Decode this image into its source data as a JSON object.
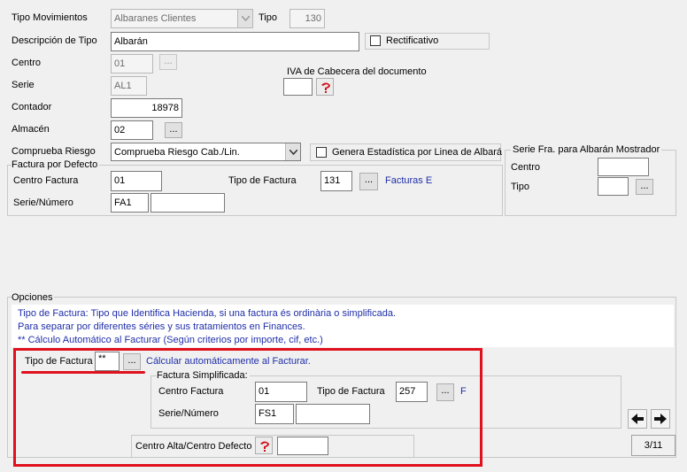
{
  "tipo_movimientos": {
    "label": "Tipo Movimientos",
    "value": "Albaranes Clientes"
  },
  "tipo": {
    "label": "Tipo",
    "value": "130"
  },
  "descripcion": {
    "label": "Descripción de Tipo",
    "value": "Albarán"
  },
  "rectificativo": {
    "label": "Rectificativo",
    "checked": false
  },
  "centro": {
    "label": "Centro",
    "value": "01",
    "button": "..."
  },
  "iva_cabecera": {
    "label": "IVA de Cabecera del documento",
    "value": ""
  },
  "serie": {
    "label": "Serie",
    "value": "AL1"
  },
  "contador": {
    "label": "Contador",
    "value": "18978"
  },
  "almacen": {
    "label": "Almacén",
    "value": "02",
    "button": "..."
  },
  "comprueba_riesgo": {
    "label": "Comprueba Riesgo",
    "value": "Comprueba Riesgo Cab./Lin."
  },
  "genera_estadistica": {
    "label": "Genera Estadística por Linea de Albará",
    "checked": false
  },
  "factura_defecto": {
    "title": "Factura por Defecto",
    "centro_label": "Centro Factura",
    "centro_value": "01",
    "tipo_label": "Tipo de Factura",
    "tipo_value": "131",
    "button": "...",
    "tipo_desc": "Facturas E",
    "serie_label": "Serie/Número",
    "serie_value": "FA1",
    "numero_value": ""
  },
  "serie_mostrador": {
    "title": "Serie Fra. para Albarán Mostrador",
    "centro_label": "Centro",
    "centro_value": "",
    "tipo_label": "Tipo",
    "tipo_value": "",
    "button": "..."
  },
  "opciones": {
    "title": "Opciones",
    "info_lines": [
      "Tipo de Factura: Tipo que Identifica Hacienda, si una factura és ordinària o simplificada.",
      "Para separar por diferentes séries y sus tratamientos en Finances.",
      "** Cálculo Automático al Facturar (Según criterios por importe, cif, etc.)"
    ],
    "tipo_factura_label": "Tipo de Factura",
    "tipo_factura_value": "**",
    "button": "...",
    "tipo_factura_desc": "Cálcular automáticamente al Facturar."
  },
  "factura_simplificada": {
    "title": "Factura Simplificada:",
    "centro_label": "Centro Factura",
    "centro_value": "01",
    "tipo_label": "Tipo de Factura",
    "tipo_value": "257",
    "button": "...",
    "tipo_desc": "F",
    "serie_label": "Serie/Número",
    "serie_value": "FS1",
    "numero_value": ""
  },
  "centro_alta": {
    "label": "Centro Alta/Centro Defecto",
    "value": ""
  },
  "pager": {
    "text": "3/11"
  },
  "colors": {
    "highlight": "#e0101c",
    "link": "#1f2ea8"
  }
}
